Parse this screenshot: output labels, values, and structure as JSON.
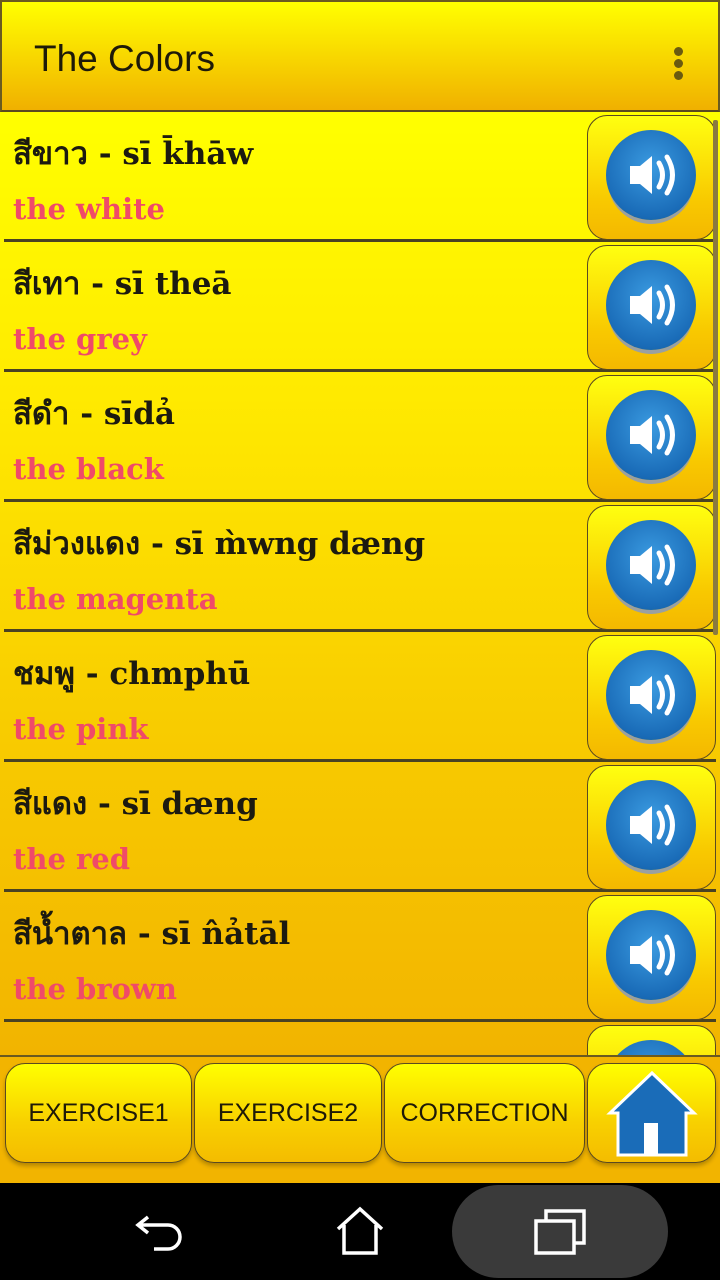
{
  "header": {
    "title": "The Colors",
    "menu_icon": "more-vert-icon"
  },
  "items": [
    {
      "thai": "สีขาว - sī k̄hāw",
      "english": "the white"
    },
    {
      "thai": "สีเทา - sī theā",
      "english": "the grey"
    },
    {
      "thai": "สีดำ - sīdả",
      "english": "the black"
    },
    {
      "thai": "สีม่วงแดง - sī m̀wng dæng",
      "english": "the magenta"
    },
    {
      "thai": "ชมพู - chmphū",
      "english": "the pink"
    },
    {
      "thai": "สีแดง - sī dæng",
      "english": "the red"
    },
    {
      "thai": "สีน้ำตาล - sī n̂ảtāl",
      "english": "the brown"
    }
  ],
  "bottom": {
    "exercise1": "EXERCISE1",
    "exercise2": "EXERCISE2",
    "correction": "CORRECTION",
    "home_icon": "home-icon"
  },
  "colors": {
    "accent": "#ffff00",
    "english_text": "#f04a68",
    "speaker": "#1a6cb8"
  }
}
